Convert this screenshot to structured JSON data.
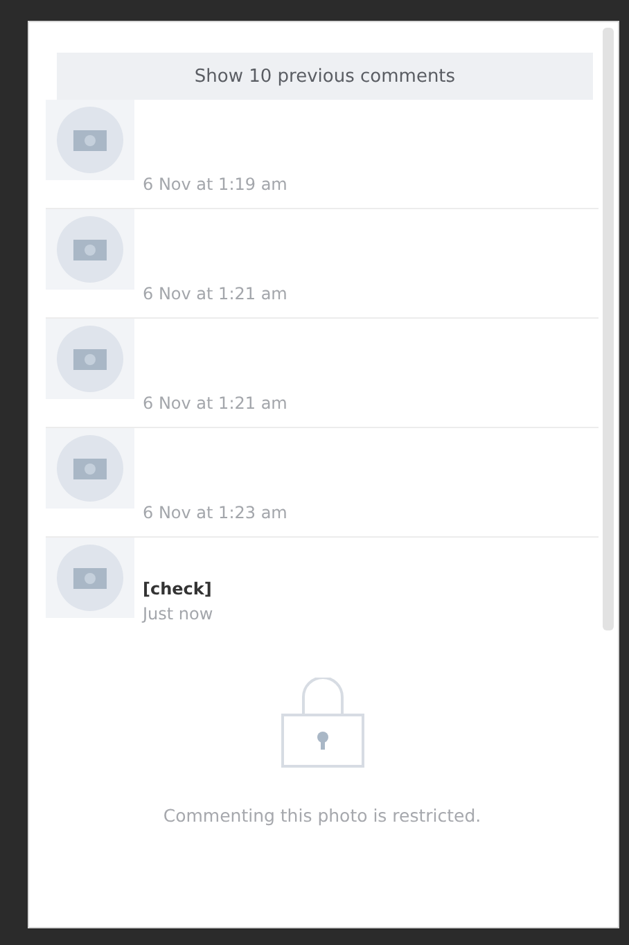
{
  "show_previous": "Show 10 previous comments",
  "comments": [
    {
      "time": "6 Nov at 1:19 am"
    },
    {
      "time": "6 Nov at 1:21 am"
    },
    {
      "time": "6 Nov at 1:21 am"
    },
    {
      "time": "6 Nov at 1:23 am"
    },
    {
      "text": "[check]",
      "time": "Just now"
    }
  ],
  "restricted_message": "Commenting this photo is restricted."
}
